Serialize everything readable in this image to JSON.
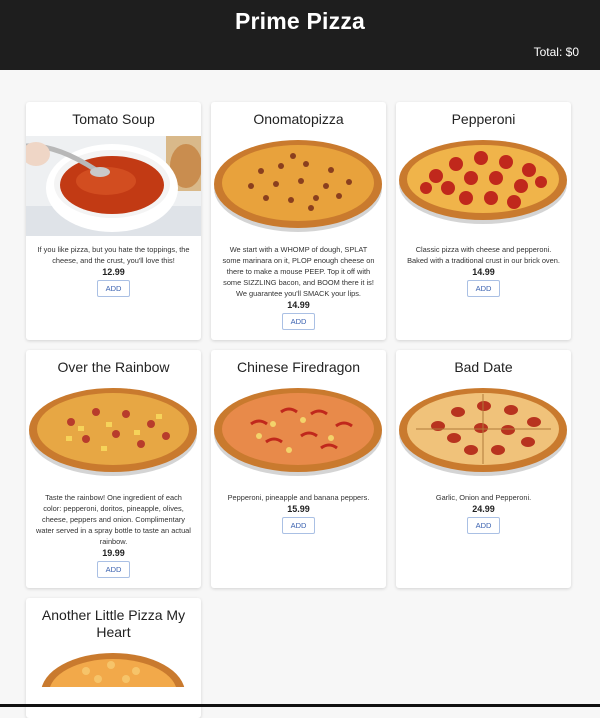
{
  "header": {
    "title": "Prime Pizza",
    "total": "Total: $0"
  },
  "products": [
    {
      "name": "Tomato Soup",
      "image": "tomato-soup-image",
      "description": "If you like pizza, but you hate the toppings, the cheese, and the crust, you'll love this!",
      "price": "12.99",
      "add_label": "ADD"
    },
    {
      "name": "Onomatopizza",
      "image": "sausage-pizza-image",
      "description": "We start with a WHOMP of dough, SPLAT some marinara on it, PLOP enough cheese on there to make a mouse PEEP. Top it off with some SIZZLING bacon, and BOOM there it is! We guarantee you'll SMACK your lips.",
      "price": "14.99",
      "add_label": "ADD"
    },
    {
      "name": "Pepperoni",
      "image": "pepperoni-pizza-image",
      "description": "Classic pizza with cheese and pepperoni. Baked with a traditional crust in our brick oven.",
      "price": "14.99",
      "add_label": "ADD"
    },
    {
      "name": "Over the Rainbow",
      "image": "rainbow-pizza-image",
      "description": "Taste the rainbow! One ingredient of each color: pepperoni, doritos, pineapple, olives, cheese, peppers and onion. Complimentary water served in a spray bottle to taste an actual rainbow.",
      "price": "19.99",
      "add_label": "ADD"
    },
    {
      "name": "Chinese Firedragon",
      "image": "firedragon-pizza-image",
      "description": "Pepperoni, pineapple and banana peppers.",
      "price": "15.99",
      "add_label": "ADD"
    },
    {
      "name": "Bad Date",
      "image": "bad-date-pizza-image",
      "description": "Garlic, Onion and Pepperoni.",
      "price": "24.99",
      "add_label": "ADD"
    },
    {
      "name": "Another Little Pizza My Heart",
      "image": "cheese-pizza-image",
      "description": "",
      "price": "",
      "add_label": ""
    }
  ]
}
